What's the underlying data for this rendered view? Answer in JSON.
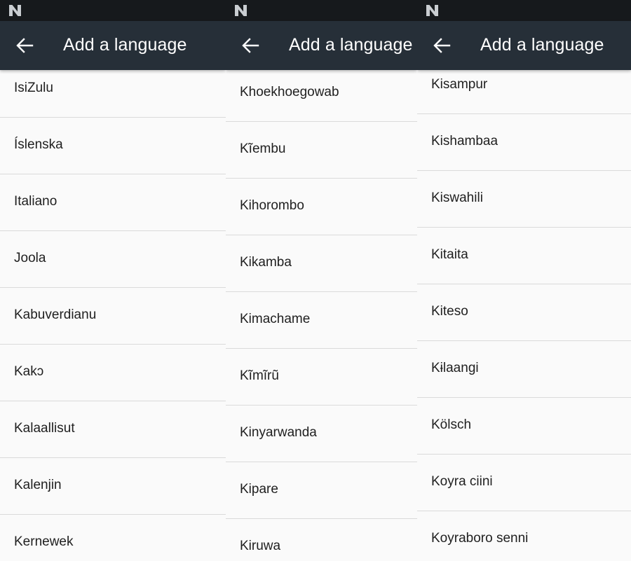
{
  "screens": [
    {
      "title": "Add a language",
      "languages": [
        "IsiZulu",
        "Íslenska",
        "Italiano",
        "Joola",
        "Kabuverdianu",
        "Kakɔ",
        "Kalaallisut",
        "Kalenjin",
        "Kernewek"
      ]
    },
    {
      "title": "Add a language",
      "languages": [
        "Khoekhoegowab",
        "Kĩembu",
        "Kihorombo",
        "Kikamba",
        "Kimachame",
        "Kĩmĩrũ",
        "Kinyarwanda",
        "Kipare",
        "Kiruwa"
      ]
    },
    {
      "title": "Add a language",
      "languages": [
        "Kisampur",
        "Kishambaa",
        "Kiswahili",
        "Kitaita",
        "Kiteso",
        "Kɨlaangi",
        "Kölsch",
        "Koyra ciini",
        "Koyraboro senni"
      ]
    }
  ],
  "colors": {
    "statusbar": "#16191c",
    "appbar": "#262f38",
    "list_background": "#fafafa",
    "divider": "#dadada",
    "text": "#1f1f1f"
  },
  "icons": {
    "status": "android-n-logo-icon",
    "back": "back-arrow-icon"
  }
}
